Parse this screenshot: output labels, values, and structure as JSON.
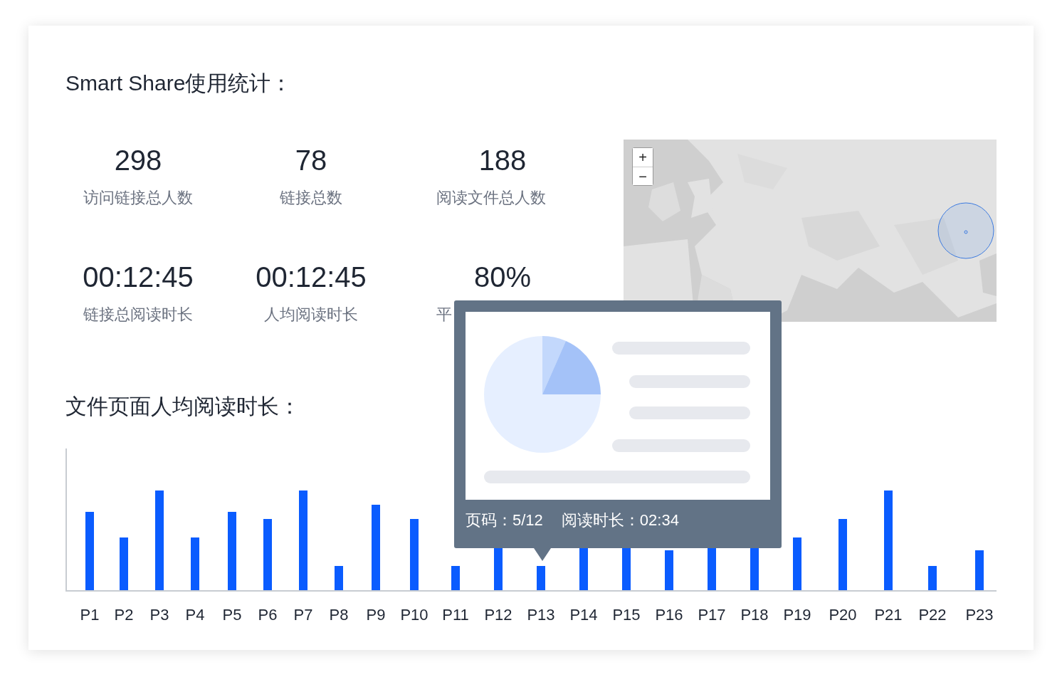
{
  "title": "Smart Share使用统计：",
  "stats": [
    {
      "value": "298",
      "label": "访问链接总人数"
    },
    {
      "value": "78",
      "label": "链接总数"
    },
    {
      "value": "188",
      "label": "阅读文件总人数"
    },
    {
      "value": "00:12:45",
      "label": "链接总阅读时长"
    },
    {
      "value": "00:12:45",
      "label": "人均阅读时长"
    },
    {
      "value": "80%",
      "label": "平"
    }
  ],
  "map": {
    "zoom_in": "+",
    "zoom_out": "−"
  },
  "chart_title": "文件页面人均阅读时长：",
  "chart": {
    "x_labels": [
      "P1",
      "P2",
      "P3",
      "P4",
      "P5",
      "P6",
      "P7",
      "P8",
      "P9",
      "P10",
      "P11",
      "P12",
      "P13",
      "P14",
      "P15",
      "P16",
      "P17",
      "P18",
      "P19",
      "P20",
      "P21",
      "P22",
      "P23"
    ]
  },
  "tooltip": {
    "page": "页码：5/12",
    "duration": "阅读时长：02:34"
  }
}
